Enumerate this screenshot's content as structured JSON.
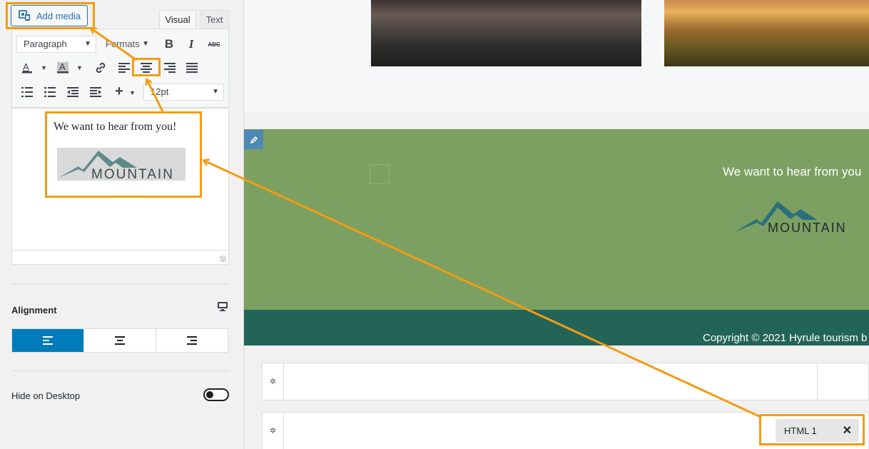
{
  "editor": {
    "add_media_label": "Add media",
    "tabs": [
      {
        "label": "Visual",
        "active": true
      },
      {
        "label": "Text",
        "active": false
      }
    ],
    "format_select": "Paragraph",
    "formats_menu": "Formats",
    "font_size_select": "12pt",
    "toolbar_icons": [
      "bold-icon",
      "italic-icon",
      "strikethrough-icon",
      "text-color-icon",
      "background-color-icon",
      "link-icon",
      "align-left-icon",
      "align-center-icon",
      "align-right-icon",
      "align-justify-icon",
      "ordered-list-icon",
      "unordered-list-icon",
      "outdent-icon",
      "indent-icon",
      "insert-plus-icon"
    ],
    "content_text": "We want to hear from you!",
    "content_logo_text": "MOUNTAIN"
  },
  "settings": {
    "alignment_label": "Alignment",
    "alignment_options": [
      "left",
      "center",
      "right"
    ],
    "alignment_selected": "left",
    "hide_desktop_label": "Hide on Desktop",
    "hide_desktop_enabled": false
  },
  "preview": {
    "green_text": "We want to hear from you",
    "logo_text": "MOUNTAIN",
    "footer_text": "Copyright © 2021 Hyrule tourism b",
    "html_chip_label": "HTML 1",
    "html_chip_close": "✕"
  },
  "colors": {
    "accent_blue": "#007cba",
    "green_band": "#7ca062",
    "footer_teal": "#236458",
    "annotation_orange": "#f39c12"
  }
}
